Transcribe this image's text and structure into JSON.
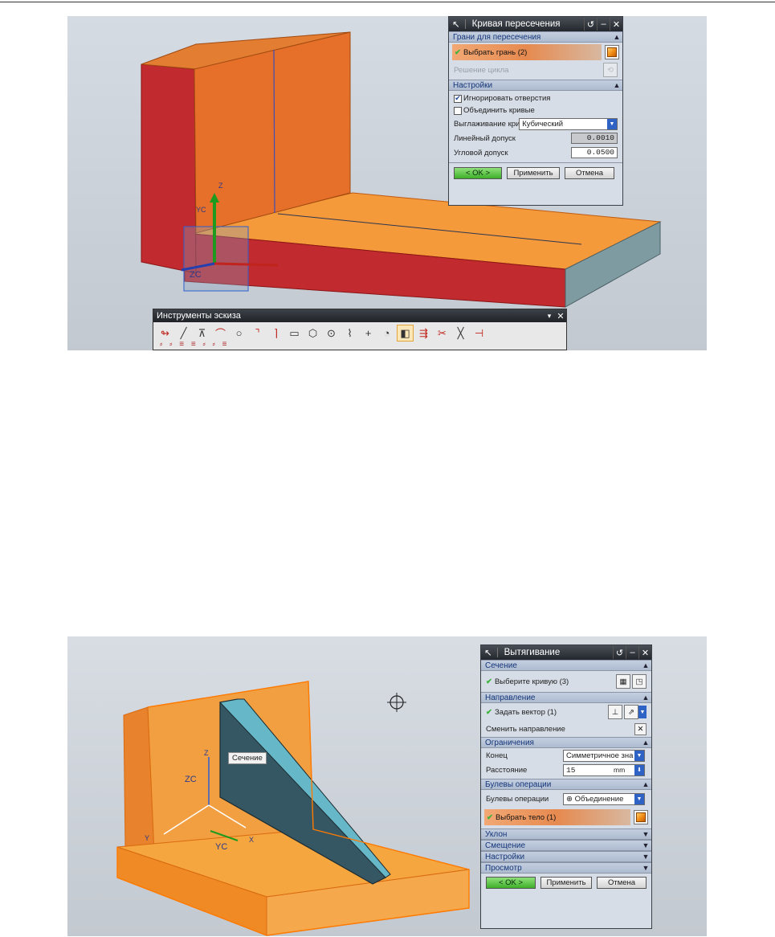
{
  "dialog1": {
    "title": "Кривая пересечения",
    "sections": {
      "faces": {
        "header": "Грани для пересечения",
        "select_face": "Выбрать грань (2)",
        "loop_solution": "Решение цикла"
      },
      "settings": {
        "header": "Настройки",
        "ignore_holes": "Игнорировать отверстия",
        "join_curves": "Объединить кривые",
        "smoothing_label": "Выглаживание кривой",
        "smoothing_value": "Кубический",
        "linear_tol_label": "Линейный допуск",
        "linear_tol_value": "0.0010",
        "angular_tol_label": "Угловой допуск",
        "angular_tol_value": "0.0500"
      }
    },
    "buttons": {
      "ok": "< OK >",
      "apply": "Применить",
      "cancel": "Отмена"
    }
  },
  "sketch_toolbar": {
    "title": "Инструменты эскиза",
    "icons": [
      "profile-icon",
      "line-icon",
      "arc-icon",
      "circle-arc-icon",
      "circle-icon",
      "fillet-icon",
      "chamfer-icon",
      "rectangle-icon",
      "polygon-icon",
      "studio-spline-icon",
      "point-icon",
      "offset-curve-icon",
      "intersection-curve-icon",
      "project-curve-icon",
      "trim-icon",
      "extend-icon",
      "split-icon",
      "dimension-icon"
    ]
  },
  "scene1": {
    "axis_z": "Z",
    "axis_yc": "YC",
    "axis_zc": "ZC"
  },
  "scene2": {
    "tooltip": "Сечение",
    "axis_z": "Z",
    "axis_zc": "ZC",
    "axis_yc": "YC",
    "axis_y": "Y",
    "axis_x": "X"
  },
  "dialog2": {
    "title": "Вытягивание",
    "section": {
      "header": "Сечение",
      "select_curve": "Выберите кривую (3)"
    },
    "direction": {
      "header": "Направление",
      "set_vector": "Задать вектор (1)",
      "reverse": "Сменить направление"
    },
    "limits": {
      "header": "Ограничения",
      "end_label": "Конец",
      "end_value": "Симметричное зна",
      "distance_label": "Расстояние",
      "distance_value": "15",
      "distance_unit": "mm"
    },
    "boolean": {
      "header": "Булевы операции",
      "label": "Булевы операции",
      "value": "Объединение",
      "select_body": "Выбрать тело (1)"
    },
    "collapsed": [
      "Уклон",
      "Смещение",
      "Настройки",
      "Просмотр"
    ],
    "buttons": {
      "ok": "< OK >",
      "apply": "Применить",
      "cancel": "Отмена"
    }
  }
}
